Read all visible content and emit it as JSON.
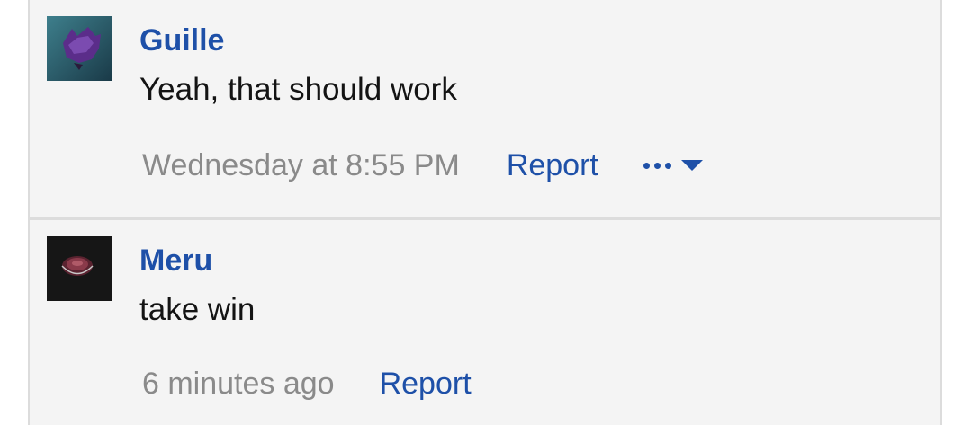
{
  "comments": [
    {
      "username": "Guille",
      "message": "Yeah, that should work",
      "timestamp": "Wednesday at 8:55 PM",
      "report_label": "Report",
      "has_more_menu": true
    },
    {
      "username": "Meru",
      "message": "take win",
      "timestamp": "6 minutes ago",
      "report_label": "Report",
      "has_more_menu": false
    }
  ],
  "colors": {
    "link": "#1e50a8",
    "text": "#141414",
    "muted": "#8a8a8a",
    "background": "#f4f4f4",
    "border": "#dcdcdc"
  }
}
